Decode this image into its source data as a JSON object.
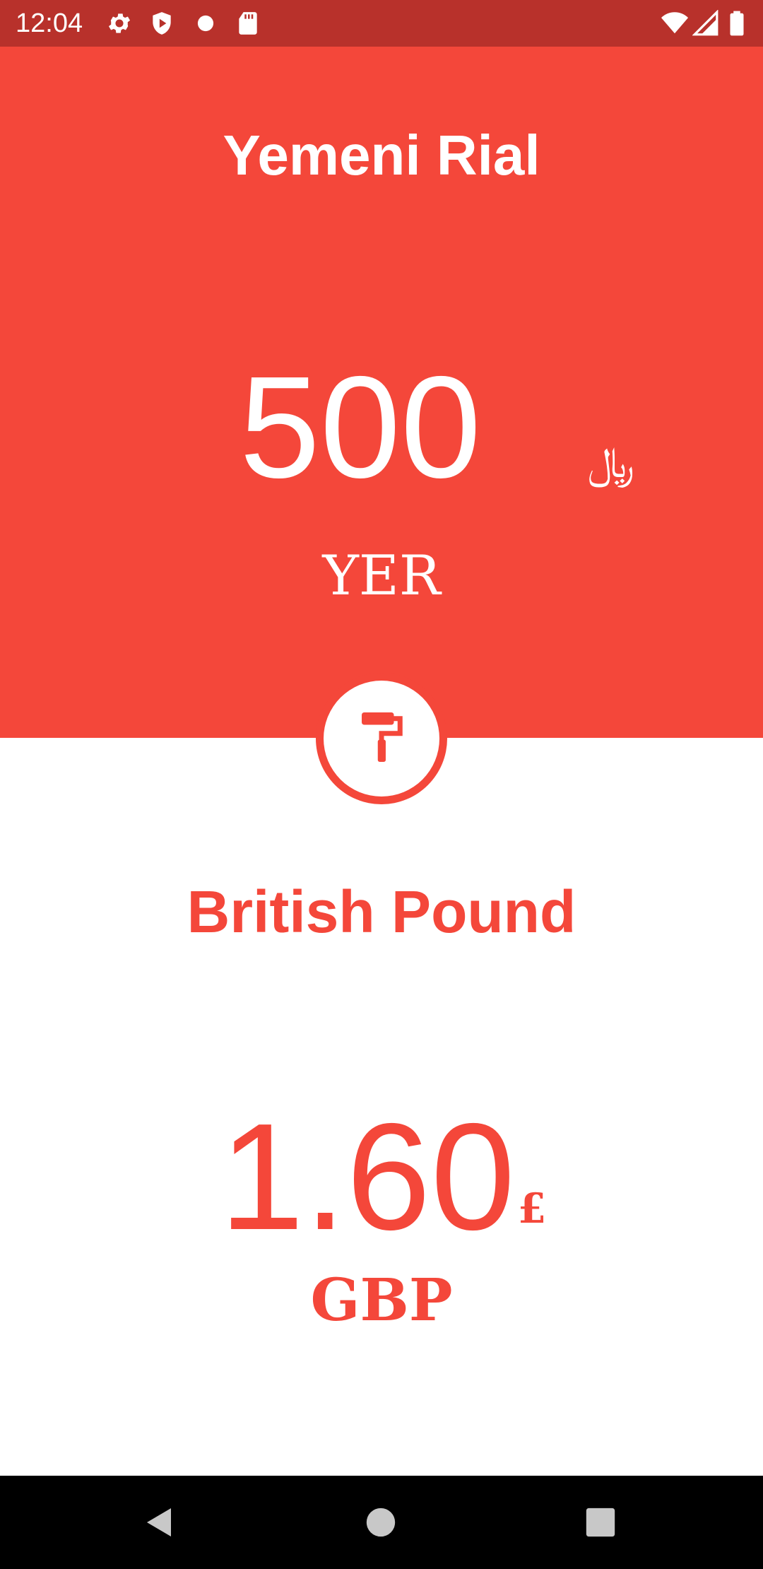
{
  "status_bar": {
    "time": "12:04",
    "left_icons": [
      "gear-icon",
      "shield-play-icon",
      "dot-icon",
      "sd-card-icon"
    ],
    "right_icons": [
      "wifi-icon",
      "signal-icon",
      "battery-icon"
    ]
  },
  "from_currency": {
    "name": "Yemeni Rial",
    "amount": "500",
    "symbol": "﷼",
    "code": "YER"
  },
  "swap_theme_button": {
    "icon": "paint-roller-icon"
  },
  "to_currency": {
    "name": "British Pound",
    "amount": "1.60",
    "symbol": "£",
    "code": "GBP"
  },
  "nav_bar": {
    "buttons": [
      "back-icon",
      "home-icon",
      "recents-icon"
    ]
  },
  "colors": {
    "accent": "#f4473a",
    "status_bar": "#b8312b",
    "background": "#ffffff",
    "nav_bar": "#000000"
  }
}
